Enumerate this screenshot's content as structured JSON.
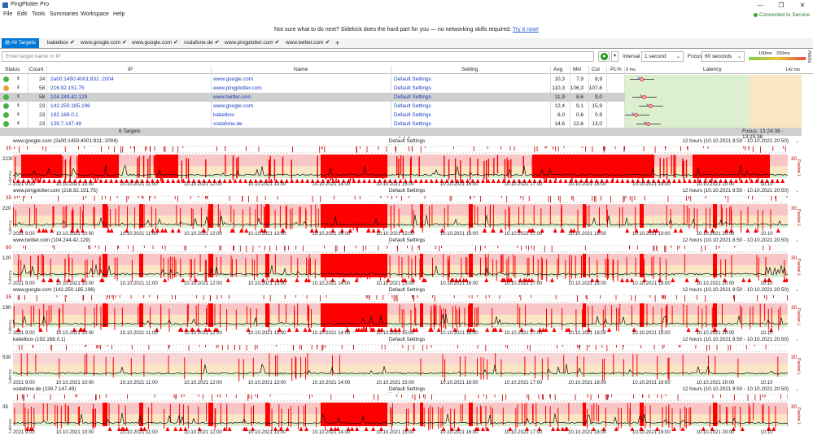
{
  "window": {
    "title": "PingPlotter Pro",
    "controls": [
      "—",
      "❐",
      "✕"
    ]
  },
  "menu": [
    "File",
    "Edit",
    "Tools",
    "Summaries",
    "Workspace",
    "Help"
  ],
  "service_status": "Connected to Service",
  "banner": {
    "text": "Not sure what to do next? Sidekick does the hard part for you — no networking skills required.",
    "link": "Try it now!"
  },
  "tabs": [
    {
      "label": "All Targets",
      "active": true
    },
    {
      "label": "kabelbox",
      "checked": true
    },
    {
      "label": "www.google.com",
      "checked": true
    },
    {
      "label": "www.google.com",
      "checked": true
    },
    {
      "label": "vodafone.de",
      "checked": true
    },
    {
      "label": "www.pingplotter.com",
      "checked": true
    },
    {
      "label": "www.twitter.com",
      "checked": true
    }
  ],
  "tab_add": "+",
  "toolbar": {
    "placeholder": "Enter target name or IP",
    "interval_label": "Interval",
    "interval_value": "1 second",
    "focus_label": "Focus",
    "focus_value": "60 seconds",
    "legend_100": "100ms",
    "legend_200": "200ms",
    "alerts": "Alerts"
  },
  "columns": {
    "status": "Status",
    "count": "Count",
    "ip": "IP",
    "name": "Name",
    "setting": "Setting",
    "avg": "Avg",
    "min": "Min",
    "cur": "Cur",
    "pl": "PL%",
    "latency": "Latency",
    "lat_min": "0 ms",
    "lat_max": "142 ms"
  },
  "targets": [
    {
      "count": "24",
      "ip": "2a00:1450:4001:831::2004",
      "name": "www.google.com",
      "setting": "Default Settings",
      "avg": "10,3",
      "min": "7,9",
      "cur": "8,9",
      "pl": "",
      "status": "#46b34a",
      "lat": 11
    },
    {
      "count": "58",
      "ip": "216.92.151.75",
      "name": "www.pingplotter.com",
      "setting": "Default Settings",
      "avg": "110,3",
      "min": "106,3",
      "cur": "107,8",
      "pl": "",
      "status": "#e8a23a",
      "lat": 165
    },
    {
      "count": "58",
      "ip": "104.244.42.129",
      "name": "www.twitter.com",
      "setting": "Default Settings",
      "avg": "11,9",
      "min": "8,6",
      "cur": "9,0",
      "pl": "",
      "status": "#46b34a",
      "lat": 13,
      "selected": true
    },
    {
      "count": "23",
      "ip": "142.250.185.196",
      "name": "www.google.com",
      "setting": "Default Settings",
      "avg": "12,4",
      "min": "9,1",
      "cur": "15,9",
      "pl": "",
      "status": "#46b34a",
      "lat": 18
    },
    {
      "count": "23",
      "ip": "192.168.0.1",
      "name": "kabelbox",
      "setting": "Default Settings",
      "avg": "6,0",
      "min": "0,6",
      "cur": "0,9",
      "pl": "",
      "status": "#46b34a",
      "lat": 6
    },
    {
      "count": "23",
      "ip": "139.7.147.49",
      "name": "vodafone.de",
      "setting": "Default Settings",
      "avg": "14,6",
      "min": "12,6",
      "cur": "13,0",
      "pl": "",
      "status": "#46b34a",
      "lat": 16
    }
  ],
  "summary": {
    "targets": "6 Targets",
    "focus": "Focus: 13:24:38 - 13:25:38"
  },
  "graph_common": {
    "setting": "Default Settings",
    "jitter": "Jitter (ms)",
    "range": "12 hours (10.10.2021 8:50 - 10.10.2021 20:50)",
    "ylabel": "Latency",
    "pl_value": "30",
    "pl_label": "Packet L",
    "ticks": [
      "2021 9:00",
      "10.10.2021 10:00",
      "10.10.2021 11:00",
      "10.10.2021 12:00",
      "10.10.2021 13:00",
      "10.10.2021 14:00",
      "10.10.2021 15:00",
      "10.10.2021 16:00",
      "10.10.2021 17:00",
      "10.10.2021 18:00",
      "10.10.2021 19:00",
      "10.10.2021 20:00",
      "10.10"
    ]
  },
  "graphs": [
    {
      "title": "www.google.com (2a00:1450:4001:831::2004)",
      "y1": "35",
      "y2": "2230",
      "seed": 3,
      "loss": "heavy"
    },
    {
      "title": "www.pingplotter.com (216.92.151.75)",
      "y1": "35",
      "y2": "220",
      "seed": 7,
      "loss": "medium"
    },
    {
      "title": "www.twitter.com (104.244.42.129)",
      "y1": "60",
      "y2": "120",
      "seed": 11,
      "loss": "medium"
    },
    {
      "title": "www.google.com (142.250.185.196)",
      "y1": "35",
      "y2": "190",
      "seed": 19,
      "loss": "medium"
    },
    {
      "title": "kabelbox (192.168.0.1)",
      "y1": "",
      "y2": "530",
      "seed": 23,
      "loss": "light"
    },
    {
      "title": "vodafone.de (139.7.147.49)",
      "y1": "",
      "y2": "35",
      "seed": 29,
      "loss": "medium"
    }
  ],
  "colors": {
    "accent": "#0078d7",
    "loss": "#ff0000",
    "lossLight": "#f8c6c6",
    "good": "#dcefcf",
    "warn": "#fbe6c4"
  }
}
